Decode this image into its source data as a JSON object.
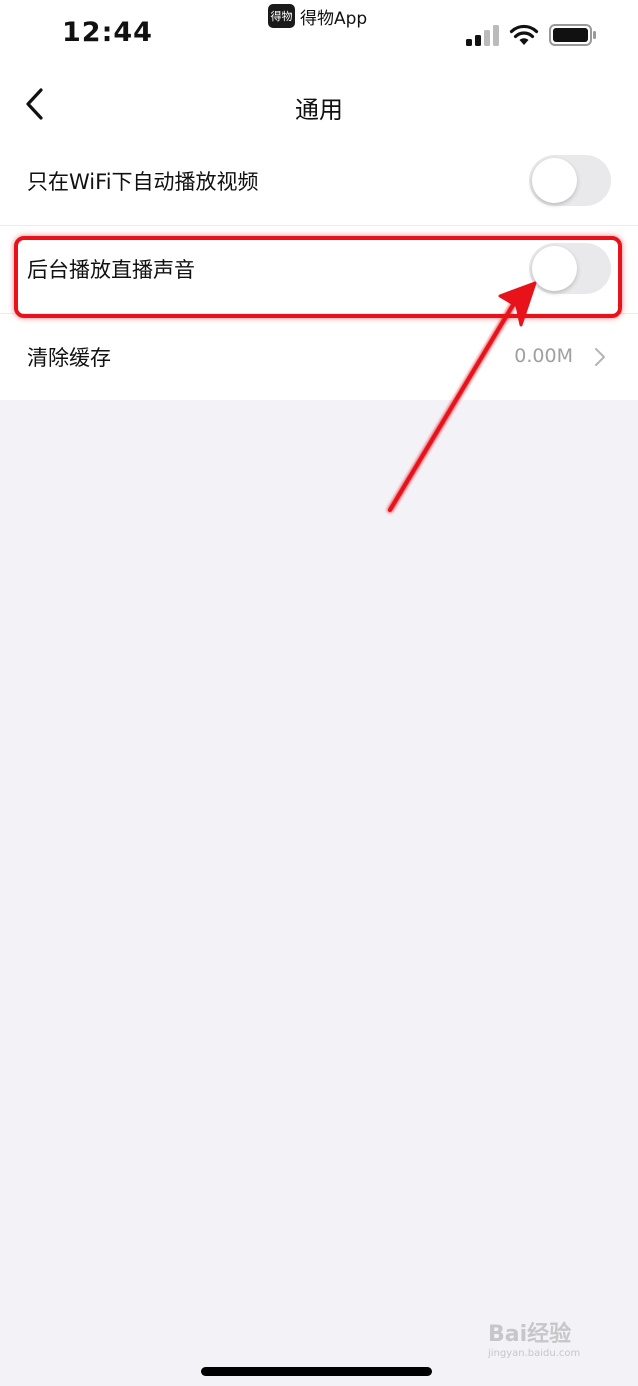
{
  "status_bar": {
    "time": "12:44",
    "app_icon_text": "得物",
    "app_name": "得物App",
    "signal_icon": "cellular-signal-icon",
    "wifi_icon": "wifi-icon",
    "battery_icon": "battery-icon"
  },
  "nav": {
    "back_icon": "chevron-left-icon",
    "title": "通用"
  },
  "settings": {
    "wifi_autoplay": {
      "label": "只在WiFi下自动播放视频",
      "toggle_on": false
    },
    "background_live_audio": {
      "label": "后台播放直播声音",
      "toggle_on": false
    },
    "clear_cache": {
      "label": "清除缓存",
      "value": "0.00M",
      "icon": "chevron-right-icon"
    }
  },
  "annotation": {
    "highlight_color": "#e8121b"
  },
  "watermark": {
    "brand": "Bai经验",
    "url": "jingyan.baidu.com"
  },
  "colors": {
    "background": "#f3f2f7",
    "toggle_off": "#e9e9eb",
    "value_text": "#a0a0a0"
  }
}
